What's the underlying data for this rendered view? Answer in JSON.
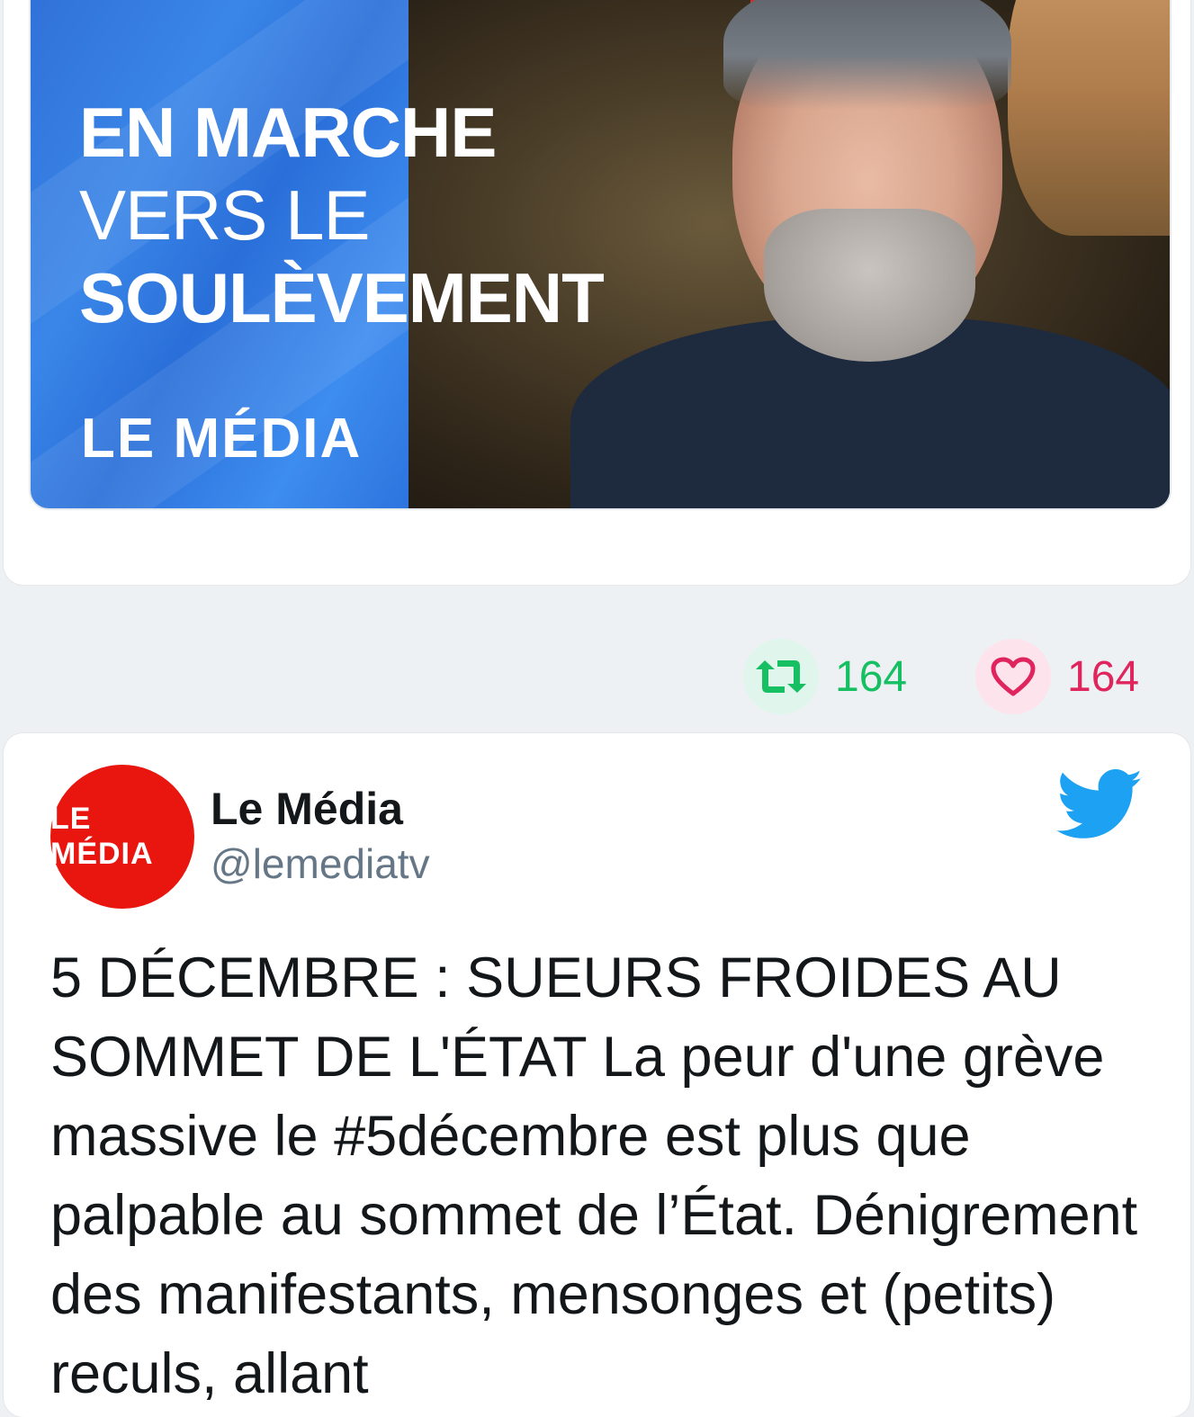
{
  "media": {
    "headline_line1": "EN MARCHE",
    "headline_line2": "VERS LE",
    "headline_line3": "SOULÈVEMENT",
    "brand": "LE MÉDIA"
  },
  "actions": {
    "retweets": "164",
    "likes": "164"
  },
  "tweet": {
    "display_name": "Le Média",
    "handle": "@lemediatv",
    "avatar_text": "LE MÉDIA",
    "text": "5 DÉCEMBRE : SUEURS FROIDES AU SOMMET DE L'ÉTAT La peur d'une grève massive le #5décembre est plus que palpable au sommet de l’État. Dénigrement des manifestants, mensonges et (petits) reculs, allant"
  },
  "colors": {
    "retweet_green": "#17bf63",
    "like_pink": "#e0245e",
    "twitter_blue": "#1da1f2",
    "brand_red": "#e8160f"
  },
  "icons": [
    "retweet-icon",
    "heart-icon",
    "twitter-bird-icon"
  ]
}
